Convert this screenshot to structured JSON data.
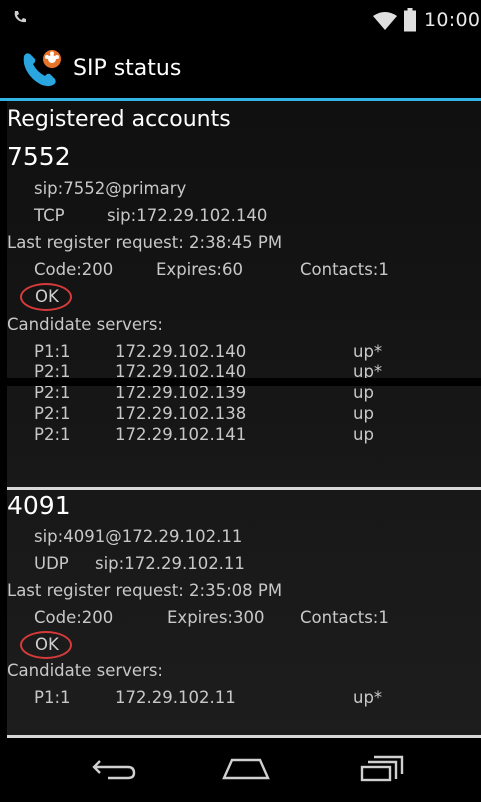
{
  "status_bar": {
    "time": "10:00"
  },
  "app": {
    "title": "SIP status"
  },
  "section_heading": "Registered accounts",
  "accounts": [
    {
      "name": "7552",
      "uri": "sip:7552@primary",
      "transport": "TCP",
      "proxy": "sip:172.29.102.140",
      "last_request": "Last register request: 2:38:45 PM",
      "code": "Code:200",
      "expires": "Expires:60",
      "contacts": "Contacts:1",
      "status": "OK",
      "candidates_label": "Candidate servers:",
      "servers": [
        {
          "id": "P1:1",
          "ip": "172.29.102.140",
          "state": "up*"
        },
        {
          "id": "P2:1",
          "ip": "172.29.102.140",
          "state": "up*"
        },
        {
          "id": "P2:1",
          "ip": "172.29.102.139",
          "state": "up"
        },
        {
          "id": "P2:1",
          "ip": "172.29.102.138",
          "state": "up"
        },
        {
          "id": "P2:1",
          "ip": "172.29.102.141",
          "state": "up"
        }
      ]
    },
    {
      "name": "4091",
      "uri": "sip:4091@172.29.102.11",
      "transport": "UDP",
      "proxy": "sip:172.29.102.11",
      "last_request": "Last register request: 2:35:08 PM",
      "code": "Code:200",
      "expires": "Expires:300",
      "contacts": "Contacts:1",
      "status": "OK",
      "candidates_label": "Candidate servers:",
      "servers": [
        {
          "id": "P1:1",
          "ip": "172.29.102.11",
          "state": "up*"
        }
      ]
    }
  ],
  "colors": {
    "accent": "#33b5e5",
    "highlight": "#d63a3a"
  }
}
